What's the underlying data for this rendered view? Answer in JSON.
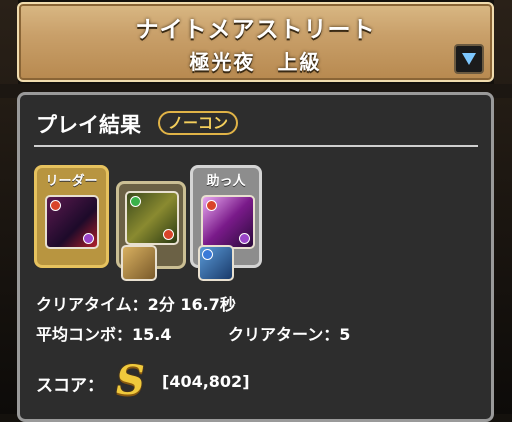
{
  "header": {
    "dungeon_title": "ナイトメアストリート",
    "difficulty": "極光夜　上級"
  },
  "result": {
    "title": "プレイ結果",
    "badge": "ノーコン",
    "team": {
      "leader_label": "リーダー",
      "helper_label": "助っ人",
      "leader_icon": "dark-dragon-monster-icon",
      "sub_icon": "green-robot-monster-icon",
      "helper_icon": "purple-mage-monster-icon",
      "assist1_icon": "gold-warrior-assist-icon",
      "assist2_icon": "blue-beast-assist-icon"
    },
    "clear_time": "クリアタイム：2分 16.7秒",
    "avg_combo": "平均コンボ：15.4",
    "clear_turn": "クリアターン：5",
    "score_label": "スコア：",
    "score_rank": "S",
    "score_value": "[404,802]"
  },
  "colors": {
    "header_gold": "#c9a06a",
    "panel_bg": "#2d2d2d",
    "badge_gold": "#e0b347",
    "rank_gold": "#f0c93c"
  }
}
